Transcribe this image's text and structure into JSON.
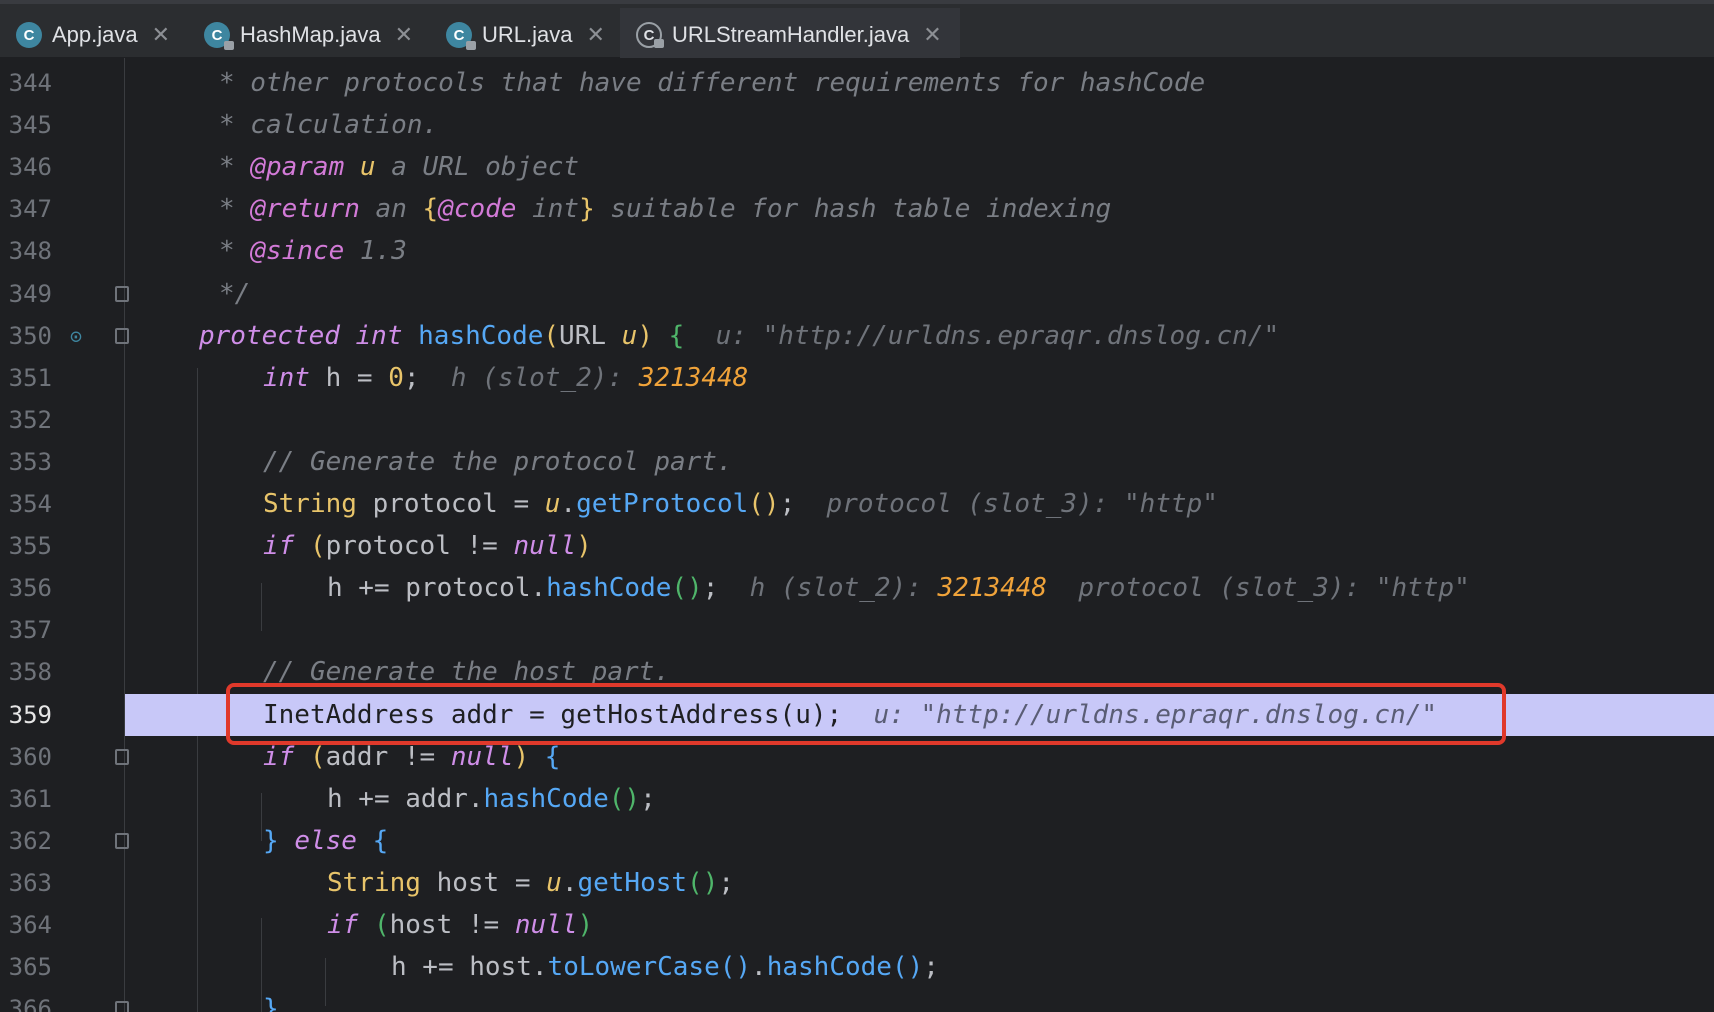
{
  "tabs": [
    {
      "label": "App.java",
      "icon": "java-class-run-icon"
    },
    {
      "label": "HashMap.java",
      "icon": "java-class-locked-icon"
    },
    {
      "label": "URL.java",
      "icon": "java-class-locked-icon"
    },
    {
      "label": "URLStreamHandler.java",
      "icon": "java-class-locked-icon",
      "active": true
    }
  ],
  "close_glyph": "✕",
  "lines": [
    {
      "n": "344",
      "tokens": [
        [
          "cm",
          "* other protocols that have different requirements for hashCode"
        ]
      ]
    },
    {
      "n": "345",
      "tokens": [
        [
          "cm",
          "* calculation."
        ]
      ]
    },
    {
      "n": "346",
      "tokens": [
        [
          "cm",
          "* "
        ],
        [
          "tag",
          "@param"
        ],
        [
          "cm",
          " "
        ],
        [
          "param",
          "u"
        ],
        [
          "cm",
          " a URL object"
        ]
      ]
    },
    {
      "n": "347",
      "tokens": [
        [
          "cm",
          "* "
        ],
        [
          "tag",
          "@return"
        ],
        [
          "cm",
          " an "
        ],
        [
          "br1",
          "{"
        ],
        [
          "tag",
          "@code"
        ],
        [
          "cm",
          " int"
        ],
        [
          "br1",
          "}"
        ],
        [
          "cm",
          " suitable for hash table indexing"
        ]
      ]
    },
    {
      "n": "348",
      "tokens": [
        [
          "cm",
          "* "
        ],
        [
          "tag",
          "@since"
        ],
        [
          "cm",
          " 1.3"
        ]
      ]
    },
    {
      "n": "349",
      "tokens": [
        [
          "cm",
          "*/"
        ]
      ]
    },
    {
      "n": "350",
      "tokens": [
        [
          "kw",
          "protected int "
        ],
        [
          "fn",
          "hashCode"
        ],
        [
          "br1",
          "("
        ],
        [
          "plain",
          "URL "
        ],
        [
          "param",
          "u"
        ],
        [
          "br1",
          ")"
        ],
        [
          "plain",
          " "
        ],
        [
          "br3",
          "{"
        ],
        [
          "hint",
          "  u: \"http://urldns.epraqr.dnslog.cn/\""
        ]
      ]
    },
    {
      "n": "351",
      "tokens": [
        [
          "kw",
          "int "
        ],
        [
          "plain",
          "h = "
        ],
        [
          "num",
          "0"
        ],
        [
          "plain",
          ";"
        ],
        [
          "hint",
          "  h (slot_2): "
        ],
        [
          "hintval",
          "3213448"
        ]
      ]
    },
    {
      "n": "352",
      "tokens": []
    },
    {
      "n": "353",
      "tokens": [
        [
          "cm",
          "// Generate the protocol part."
        ]
      ]
    },
    {
      "n": "354",
      "tokens": [
        [
          "ty",
          "String "
        ],
        [
          "plain",
          "protocol = "
        ],
        [
          "param",
          "u"
        ],
        [
          "plain",
          "."
        ],
        [
          "fn",
          "getProtocol"
        ],
        [
          "br1",
          "()"
        ],
        [
          "plain",
          ";"
        ],
        [
          "hint",
          "  protocol (slot_3): \"http\""
        ]
      ]
    },
    {
      "n": "355",
      "tokens": [
        [
          "kw",
          "if "
        ],
        [
          "br1",
          "("
        ],
        [
          "plain",
          "protocol != "
        ],
        [
          "kw",
          "null"
        ],
        [
          "br1",
          ")"
        ]
      ]
    },
    {
      "n": "356",
      "tokens": [
        [
          "plain",
          "h += protocol."
        ],
        [
          "fn",
          "hashCode"
        ],
        [
          "br3",
          "()"
        ],
        [
          "plain",
          ";"
        ],
        [
          "hint",
          "  h (slot_2): "
        ],
        [
          "hintval",
          "3213448"
        ],
        [
          "hint",
          "  protocol (slot_3): \"http\""
        ]
      ]
    },
    {
      "n": "357",
      "tokens": []
    },
    {
      "n": "358",
      "tokens": [
        [
          "cm",
          "// Generate the host part."
        ]
      ]
    },
    {
      "n": "359",
      "tokens": [
        [
          "plain",
          "InetAddress addr = getHostAddress(u);"
        ],
        [
          "hint",
          "  u: \"http://urldns.epraqr.dnslog.cn/\""
        ]
      ]
    },
    {
      "n": "360",
      "tokens": [
        [
          "kw",
          "if "
        ],
        [
          "br1",
          "("
        ],
        [
          "plain",
          "addr != "
        ],
        [
          "kw",
          "null"
        ],
        [
          "br1",
          ")"
        ],
        [
          "plain",
          " "
        ],
        [
          "br2",
          "{"
        ]
      ]
    },
    {
      "n": "361",
      "tokens": [
        [
          "plain",
          "h += addr."
        ],
        [
          "fn",
          "hashCode"
        ],
        [
          "br3",
          "()"
        ],
        [
          "plain",
          ";"
        ]
      ]
    },
    {
      "n": "362",
      "tokens": [
        [
          "br2",
          "} "
        ],
        [
          "kw",
          "else "
        ],
        [
          "br2",
          "{"
        ]
      ]
    },
    {
      "n": "363",
      "tokens": [
        [
          "ty",
          "String "
        ],
        [
          "plain",
          "host = "
        ],
        [
          "param",
          "u"
        ],
        [
          "plain",
          "."
        ],
        [
          "fn",
          "getHost"
        ],
        [
          "br3",
          "()"
        ],
        [
          "plain",
          ";"
        ]
      ]
    },
    {
      "n": "364",
      "tokens": [
        [
          "kw",
          "if "
        ],
        [
          "br3",
          "("
        ],
        [
          "plain",
          "host != "
        ],
        [
          "kw",
          "null"
        ],
        [
          "br3",
          ")"
        ]
      ]
    },
    {
      "n": "365",
      "tokens": [
        [
          "plain",
          "h += host."
        ],
        [
          "fn",
          "toLowerCase"
        ],
        [
          "br2",
          "()"
        ],
        [
          "plain",
          "."
        ],
        [
          "fn",
          "hashCode"
        ],
        [
          "br2",
          "()"
        ],
        [
          "plain",
          ";"
        ]
      ]
    },
    {
      "n": "366",
      "tokens": [
        [
          "br2",
          "}"
        ]
      ]
    }
  ]
}
